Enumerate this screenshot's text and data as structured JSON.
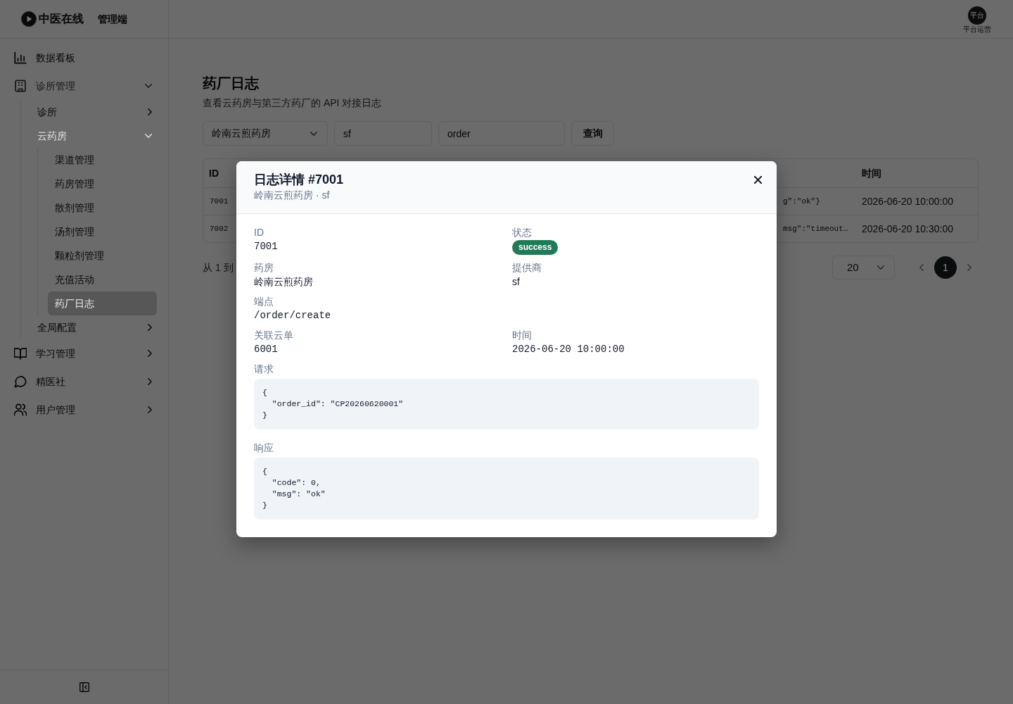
{
  "header": {
    "logo_text": "中医在线",
    "app_label": "管理端",
    "user": {
      "avatar_text": "平台",
      "role": "平台运营"
    }
  },
  "sidebar": {
    "items": [
      {
        "label": "数据看板",
        "selected": false
      },
      {
        "label": "诊所管理",
        "selected": false,
        "expanded": true,
        "children": [
          {
            "label": "诊所",
            "selected": false,
            "expanded": false
          },
          {
            "label": "云药房",
            "selected": false,
            "expanded": true,
            "children": [
              {
                "label": "渠道管理",
                "selected": false
              },
              {
                "label": "药房管理",
                "selected": false
              },
              {
                "label": "散剂管理",
                "selected": false
              },
              {
                "label": "汤剂管理",
                "selected": false
              },
              {
                "label": "颗粒剂管理",
                "selected": false
              },
              {
                "label": "充值活动",
                "selected": false
              },
              {
                "label": "药厂日志",
                "selected": true
              }
            ]
          },
          {
            "label": "全局配置",
            "selected": false,
            "expanded": false
          }
        ]
      },
      {
        "label": "学习管理",
        "selected": false,
        "expanded": false
      },
      {
        "label": "精医社",
        "selected": false,
        "expanded": false
      },
      {
        "label": "用户管理",
        "selected": false,
        "expanded": false
      }
    ]
  },
  "page": {
    "title": "药厂日志",
    "subtitle": "查看云药房与第三方药厂的 API 对接日志",
    "filters": {
      "pharmacy": {
        "value": "岭南云煎药房"
      },
      "provider": {
        "value": "sf"
      },
      "endpoint": {
        "value": "order"
      },
      "search_button": "查询"
    },
    "table": {
      "id_heading": "ID",
      "time_heading": "时间",
      "rows": [
        {
          "id": "7001",
          "column_2": "g\":\"ok\"}",
          "time": "2026-06-20 10:00:00"
        },
        {
          "id": "7002",
          "column_2": "msg\":\"timeout…",
          "time": "2026-06-20 10:30:00"
        }
      ]
    },
    "pagination": {
      "range_text": "从 1 到",
      "page_size": "20",
      "pages": [
        {
          "label": "1",
          "selected": true
        }
      ]
    }
  },
  "dialog": {
    "title": "日志详情 #7001",
    "subtitle": "岭南云煎药房 · sf",
    "field_rows": [
      {
        "fields": [
          {
            "label": "ID",
            "value": "7001",
            "kind": "mono"
          },
          {
            "label": "状态",
            "value": "success",
            "kind": "badge"
          }
        ]
      },
      {
        "fields": [
          {
            "label": "药房",
            "value": "岭南云煎药房",
            "kind": "text"
          },
          {
            "label": "提供商",
            "value": "sf",
            "kind": "text"
          }
        ]
      },
      {
        "fields": [
          {
            "label": "端点",
            "value": "/order/create",
            "kind": "mono"
          }
        ]
      },
      {
        "fields": [
          {
            "label": "关联云单",
            "value": "6001",
            "kind": "mono"
          },
          {
            "label": "时间",
            "value": "2026-06-20 10:00:00",
            "kind": "mono"
          }
        ]
      }
    ],
    "request": {
      "label": "请求",
      "code": "{\n  \"order_id\": \"CP20260620001\"\n}"
    },
    "response": {
      "label": "响应",
      "code": "{\n  \"code\": 0,\n  \"msg\": \"ok\"\n}"
    }
  }
}
